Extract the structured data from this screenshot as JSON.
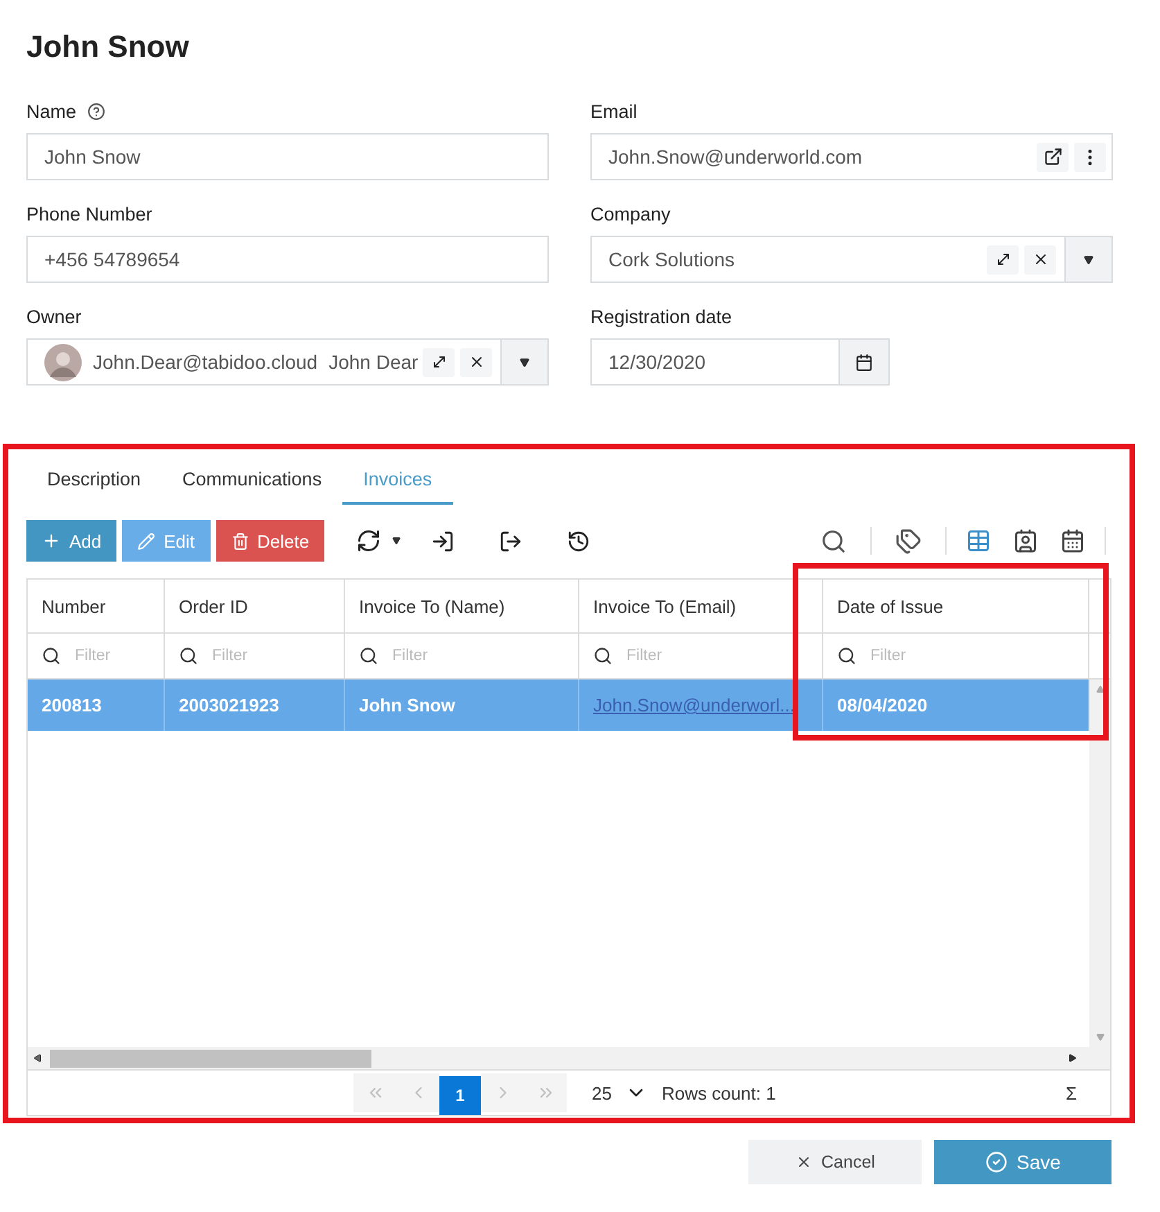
{
  "title": "John Snow",
  "fields": [
    {
      "label": "Name",
      "help": true,
      "kind": "text",
      "value": "John Snow"
    },
    {
      "label": "Email",
      "help": false,
      "kind": "email",
      "value": "John.Snow@underworld.com"
    },
    {
      "label": "Phone Number",
      "help": false,
      "kind": "text",
      "value": "+456 54789654"
    },
    {
      "label": "Company",
      "help": false,
      "kind": "lookup",
      "value": "Cork Solutions"
    },
    {
      "label": "Owner",
      "help": false,
      "kind": "user",
      "value": "John.Dear@tabidoo.cloud",
      "secondary": "John Dear"
    },
    {
      "label": "Registration date",
      "help": false,
      "kind": "date",
      "value": "12/30/2020"
    }
  ],
  "tabs": [
    {
      "label": "Description",
      "selected": false
    },
    {
      "label": "Communications",
      "selected": false
    },
    {
      "label": "Invoices",
      "selected": true
    }
  ],
  "toolbar": [
    {
      "label": "Add",
      "kind": "add"
    },
    {
      "label": "Edit",
      "kind": "edit"
    },
    {
      "label": "Delete",
      "kind": "delete"
    }
  ],
  "table": {
    "columns": [
      {
        "label": "Number",
        "placeholder": "Filter"
      },
      {
        "label": "Order ID",
        "placeholder": "Filter"
      },
      {
        "label": "Invoice To (Name)",
        "placeholder": "Filter"
      },
      {
        "label": "Invoice To (Email)",
        "placeholder": "Filter"
      },
      {
        "label": "Date of Issue",
        "placeholder": "Filter"
      }
    ],
    "rows": [
      {
        "selected": true,
        "cells": [
          {
            "text": "200813",
            "kind": "text"
          },
          {
            "text": "2003021923",
            "kind": "text"
          },
          {
            "text": "John Snow",
            "kind": "text"
          },
          {
            "text": "John.Snow@underworl...",
            "kind": "link"
          },
          {
            "text": "08/04/2020",
            "kind": "text"
          }
        ]
      }
    ]
  },
  "pager": {
    "pages": [
      {
        "label": "1",
        "selected": true
      }
    ],
    "page_size": "25",
    "rows_count": "Rows count: 1",
    "sum": "Σ"
  },
  "actions": [
    {
      "label": "Cancel",
      "kind": "cancel"
    },
    {
      "label": "Save",
      "kind": "save"
    }
  ]
}
